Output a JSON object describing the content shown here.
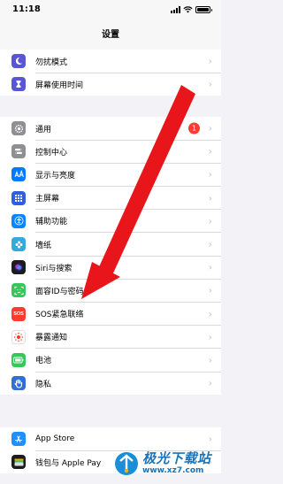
{
  "status": {
    "time": "11:18"
  },
  "nav": {
    "title": "设置"
  },
  "groups": [
    {
      "items": [
        {
          "label": "勿扰模式",
          "icon": "moon-icon",
          "color": "#5856d6"
        },
        {
          "label": "屏幕使用时间",
          "icon": "hourglass-icon",
          "color": "#5856d6"
        }
      ]
    },
    {
      "items": [
        {
          "label": "通用",
          "icon": "gear-icon",
          "color": "#8e8e93",
          "badge": "1"
        },
        {
          "label": "控制中心",
          "icon": "toggles-icon",
          "color": "#8e8e93"
        },
        {
          "label": "显示与亮度",
          "icon": "text-size-icon",
          "color": "#007aff"
        },
        {
          "label": "主屏幕",
          "icon": "grid-icon",
          "color": "#2f5fe0"
        },
        {
          "label": "辅助功能",
          "icon": "accessibility-icon",
          "color": "#0a84ff"
        },
        {
          "label": "墙纸",
          "icon": "flower-icon",
          "color": "#34aadc"
        },
        {
          "label": "Siri与搜索",
          "icon": "siri-icon",
          "color": "#1c1c1e"
        },
        {
          "label": "面容ID与密码",
          "icon": "face-id-icon",
          "color": "#34c759"
        },
        {
          "label": "SOS紧急联络",
          "icon": "sos-icon",
          "color": "#ff3b30"
        },
        {
          "label": "暴露通知",
          "icon": "exposure-icon",
          "color": "#ffffff"
        },
        {
          "label": "电池",
          "icon": "battery-icon",
          "color": "#34c759"
        },
        {
          "label": "隐私",
          "icon": "hand-icon",
          "color": "#2f6fd6"
        }
      ]
    },
    {
      "items": [
        {
          "label": "App Store",
          "icon": "app-store-icon",
          "color": "#1e90ff"
        },
        {
          "label": "钱包与 Apple Pay",
          "icon": "wallet-icon",
          "color": "#1c1c1e"
        }
      ]
    }
  ],
  "watermark": {
    "name": "极光下载站",
    "url": "www.xz7.com"
  }
}
